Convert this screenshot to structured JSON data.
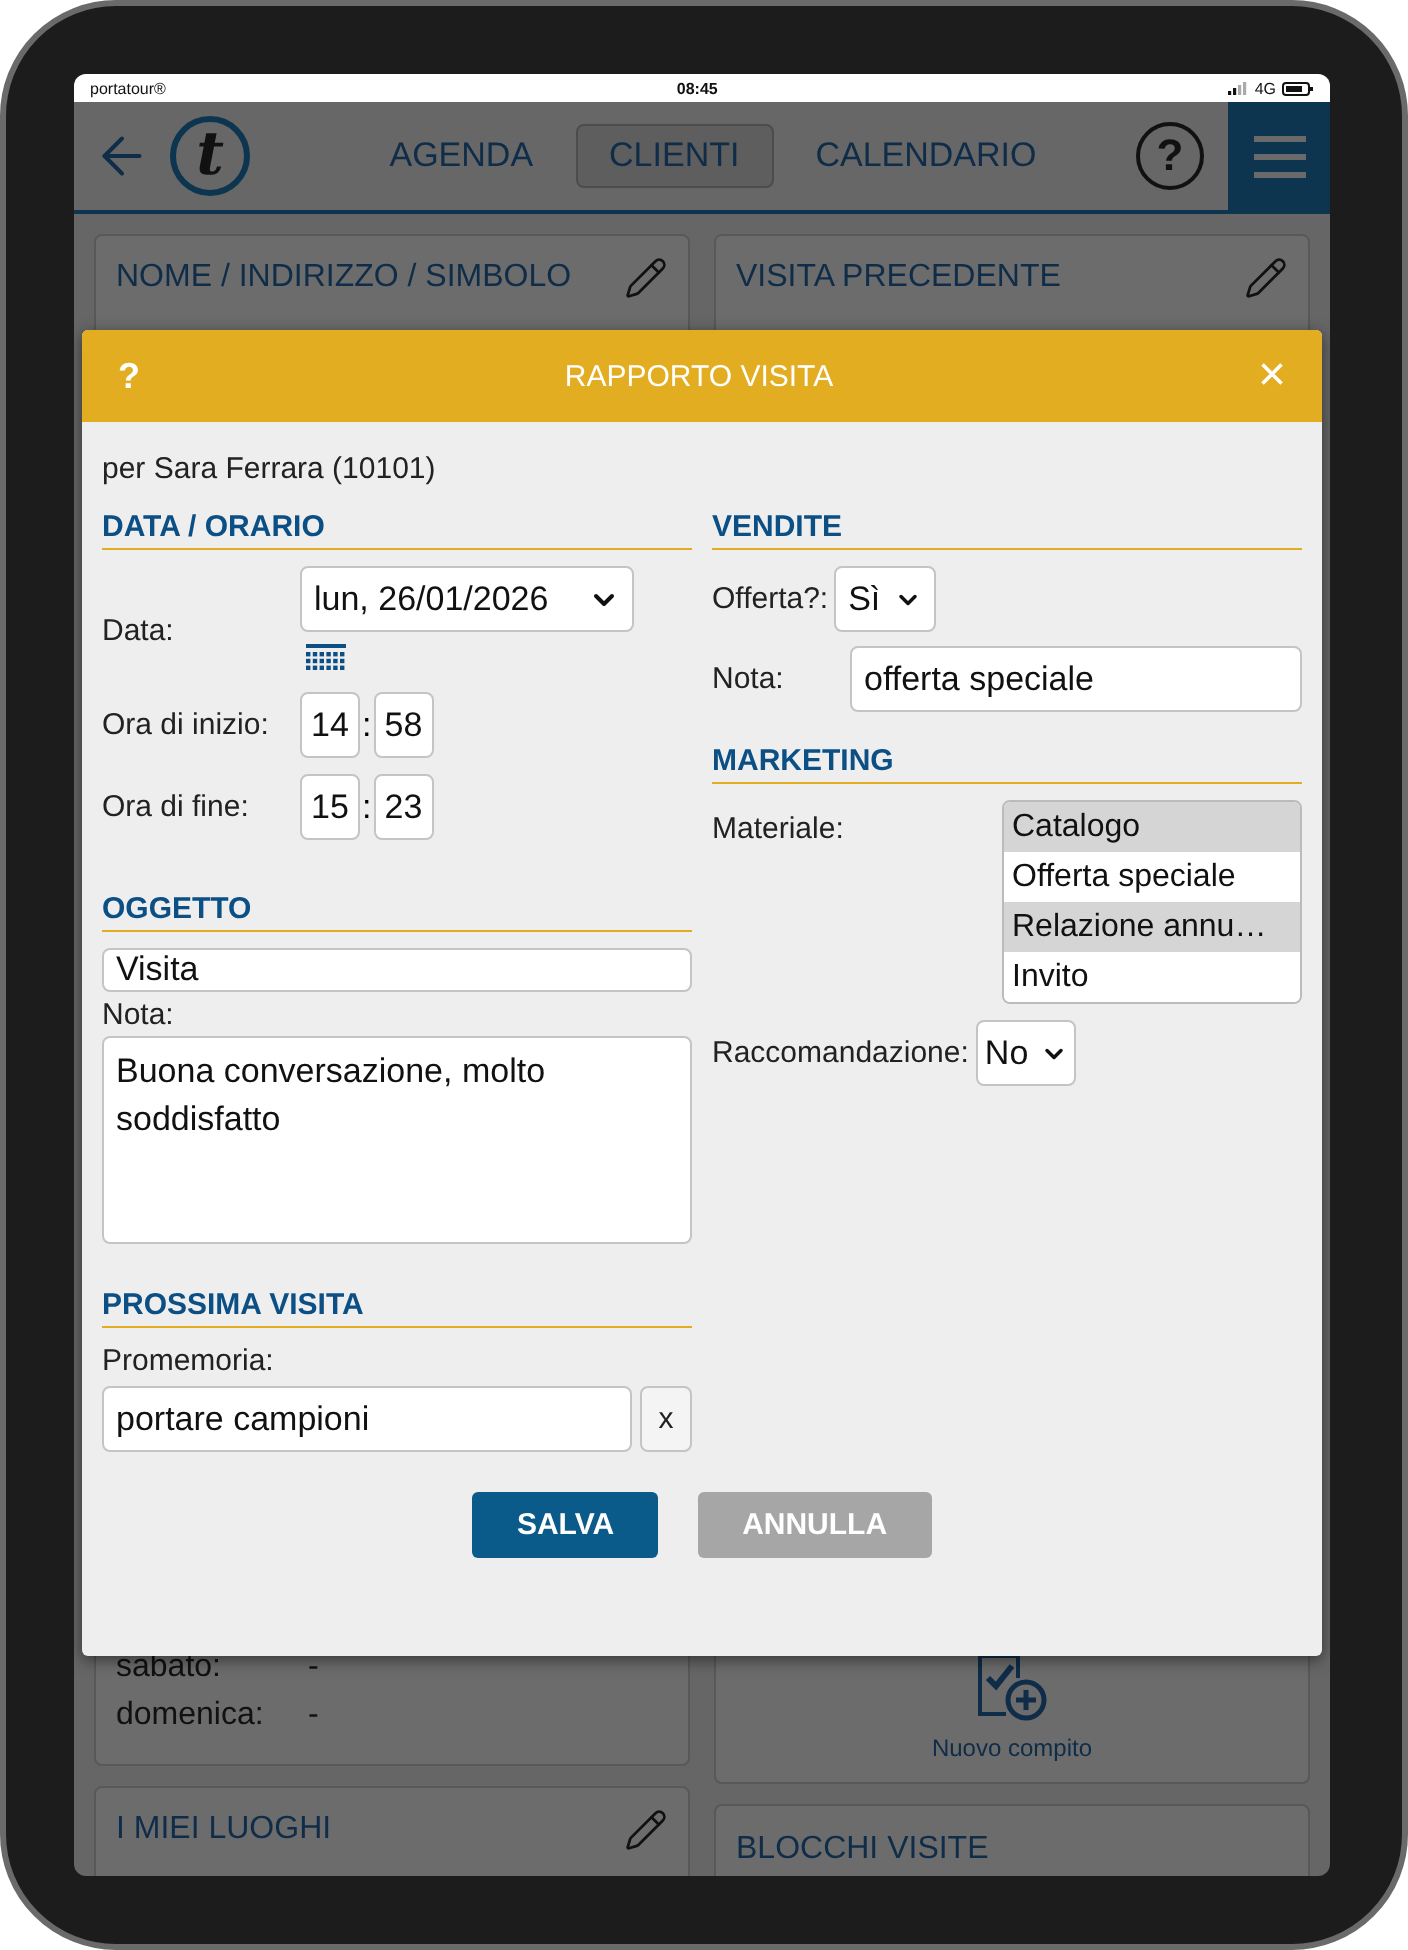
{
  "status_bar": {
    "carrier": "portatour®",
    "time": "08:45",
    "network": "4G"
  },
  "nav": {
    "logo": "t",
    "help": "?",
    "tabs": [
      {
        "label": "AGENDA",
        "selected": false
      },
      {
        "label": "CLIENTI",
        "selected": true
      },
      {
        "label": "CALENDARIO",
        "selected": false
      }
    ]
  },
  "background_cards": {
    "left": [
      {
        "title": "NOME / INDIRIZZO / SIMBOLO",
        "editable": true,
        "rows": [
          {
            "label": "sabato:",
            "value": "-"
          },
          {
            "label": "domenica:",
            "value": "-"
          }
        ]
      },
      {
        "title": "I MIEI LUOGHI",
        "editable": true
      }
    ],
    "right": [
      {
        "kind": "section",
        "title": "VISITA PRECEDENTE",
        "editable": true
      },
      {
        "kind": "action",
        "label": "Nuovo compito"
      },
      {
        "kind": "section",
        "title": "BLOCCHI VISITE",
        "editable": false
      }
    ]
  },
  "dialog": {
    "help": "?",
    "title": "RAPPORTO VISITA",
    "close": "×",
    "subtitle": "per Sara Ferrara (10101)",
    "date_time": {
      "heading": "DATA / ORARIO",
      "date_label": "Data:",
      "date_value": "lun, 26/01/2026",
      "times": [
        {
          "label": "Ora di inizio:",
          "hour": "14",
          "separator": ":",
          "minute": "58"
        },
        {
          "label": "Ora di fine:",
          "hour": "15",
          "separator": ":",
          "minute": "23"
        }
      ]
    },
    "subject": {
      "heading": "OGGETTO",
      "value": "Visita",
      "note_label": "Nota:",
      "note": "Buona conversazione, molto soddisfatto"
    },
    "next_visit": {
      "heading": "PROSSIMA VISITA",
      "label": "Promemoria:",
      "value": "portare campioni",
      "clear": "x"
    },
    "sales": {
      "heading": "VENDITE",
      "offer_label": "Offerta?:",
      "offer_value": "Sì",
      "note_label": "Nota:",
      "note": "offerta speciale"
    },
    "marketing": {
      "heading": "MARKETING",
      "material_label": "Materiale:",
      "options": [
        {
          "label": "Catalogo",
          "selected": true
        },
        {
          "label": "Offerta speciale",
          "selected": false
        },
        {
          "label": "Relazione annu…",
          "selected": true
        },
        {
          "label": "Invito",
          "selected": false
        }
      ],
      "recommendation_label": "Raccomandazione:",
      "recommendation_value": "No"
    },
    "buttons": [
      {
        "label": "SALVA",
        "disabled": false
      },
      {
        "label": "ANNULLA",
        "disabled": true
      }
    ]
  }
}
